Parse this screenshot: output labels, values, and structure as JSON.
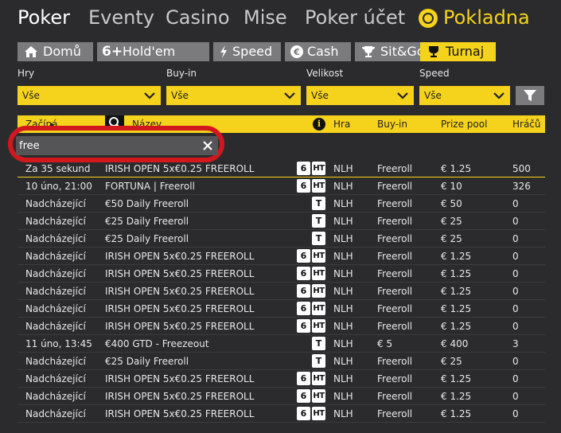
{
  "topnav": {
    "poker": "Poker",
    "eventy": "Eventy",
    "casino": "Casino",
    "mise": "Mise",
    "account": "Poker účet",
    "cashier": "Pokladna"
  },
  "tabs": [
    {
      "label": "Domů",
      "icon": "home-icon"
    },
    {
      "label": "Hold'em",
      "icon": "six-plus-icon",
      "icon_text": "6+"
    },
    {
      "label": "Speed",
      "icon": "lightning-icon"
    },
    {
      "label": "Cash",
      "icon": "euro-icon"
    },
    {
      "label": "Sit&Go",
      "icon": "trophy-icon"
    },
    {
      "label": "Turnaj",
      "icon": "cup-icon",
      "active": true
    }
  ],
  "filters": {
    "games": {
      "label": "Hry",
      "value": "Vše"
    },
    "buyin": {
      "label": "Buy-in",
      "value": "Vše"
    },
    "size": {
      "label": "Velikost",
      "value": "Vše"
    },
    "speed": {
      "label": "Speed",
      "value": "Vše"
    }
  },
  "table": {
    "headers": {
      "starts": "Začíná",
      "name": "Název",
      "info_icon": "i",
      "game": "Hra",
      "buyin": "Buy-in",
      "prize": "Prize pool",
      "players": "Hráčů"
    },
    "search": {
      "value": "free"
    },
    "rows": [
      {
        "starts": "Za 35 sekund",
        "name": "IRISH OPEN 5x€0.25 FREEROLL",
        "b6": "6",
        "ht": "HT",
        "t": "",
        "game": "NLH",
        "buyin": "Freeroll",
        "prize": "€ 1.25",
        "players": "500"
      },
      {
        "starts": "10 úno, 21:00",
        "name": "FORTUNA | Freeroll",
        "b6": "6",
        "ht": "HT",
        "t": "",
        "game": "NLH",
        "buyin": "Freeroll",
        "prize": "€ 10",
        "players": "326"
      },
      {
        "starts": "Nadcházející",
        "name": "€50 Daily Freeroll",
        "b6": "",
        "ht": "",
        "t": "T",
        "game": "NLH",
        "buyin": "Freeroll",
        "prize": "€ 50",
        "players": "0"
      },
      {
        "starts": "Nadcházející",
        "name": "€25 Daily Freeroll",
        "b6": "",
        "ht": "",
        "t": "T",
        "game": "NLH",
        "buyin": "Freeroll",
        "prize": "€ 25",
        "players": "0"
      },
      {
        "starts": "Nadcházející",
        "name": "€25 Daily Freeroll",
        "b6": "",
        "ht": "",
        "t": "T",
        "game": "NLH",
        "buyin": "Freeroll",
        "prize": "€ 25",
        "players": "0"
      },
      {
        "starts": "Nadcházející",
        "name": "IRISH OPEN 5x€0.25 FREEROLL",
        "b6": "6",
        "ht": "HT",
        "t": "",
        "game": "NLH",
        "buyin": "Freeroll",
        "prize": "€ 1.25",
        "players": "0"
      },
      {
        "starts": "Nadcházející",
        "name": "IRISH OPEN 5x€0.25 FREEROLL",
        "b6": "6",
        "ht": "HT",
        "t": "",
        "game": "NLH",
        "buyin": "Freeroll",
        "prize": "€ 1.25",
        "players": "0"
      },
      {
        "starts": "Nadcházející",
        "name": "IRISH OPEN 5x€0.25 FREEROLL",
        "b6": "6",
        "ht": "HT",
        "t": "",
        "game": "NLH",
        "buyin": "Freeroll",
        "prize": "€ 1.25",
        "players": "0"
      },
      {
        "starts": "Nadcházející",
        "name": "IRISH OPEN 5x€0.25 FREEROLL",
        "b6": "6",
        "ht": "HT",
        "t": "",
        "game": "NLH",
        "buyin": "Freeroll",
        "prize": "€ 1.25",
        "players": "0"
      },
      {
        "starts": "Nadcházející",
        "name": "IRISH OPEN 5x€0.25 FREEROLL",
        "b6": "6",
        "ht": "HT",
        "t": "",
        "game": "NLH",
        "buyin": "Freeroll",
        "prize": "€ 1.25",
        "players": "0"
      },
      {
        "starts": "11 úno, 13:45",
        "name": "€400 GTD - Freezeout",
        "b6": "",
        "ht": "",
        "t": "T",
        "game": "NLH",
        "buyin": "€ 5",
        "prize": "€ 400",
        "players": "3"
      },
      {
        "starts": "Nadcházející",
        "name": "€25 Daily Freeroll",
        "b6": "",
        "ht": "",
        "t": "T",
        "game": "NLH",
        "buyin": "Freeroll",
        "prize": "€ 25",
        "players": "0"
      },
      {
        "starts": "Nadcházející",
        "name": "IRISH OPEN 5x€0.25 FREEROLL",
        "b6": "6",
        "ht": "HT",
        "t": "",
        "game": "NLH",
        "buyin": "Freeroll",
        "prize": "€ 1.25",
        "players": "0"
      },
      {
        "starts": "Nadcházející",
        "name": "IRISH OPEN 5x€0.25 FREEROLL",
        "b6": "6",
        "ht": "HT",
        "t": "",
        "game": "NLH",
        "buyin": "Freeroll",
        "prize": "€ 1.25",
        "players": "0"
      },
      {
        "starts": "Nadcházející",
        "name": "IRISH OPEN 5x€0.25 FREEROLL",
        "b6": "6",
        "ht": "HT",
        "t": "",
        "game": "NLH",
        "buyin": "Freeroll",
        "prize": "€ 1.25",
        "players": "0"
      }
    ]
  },
  "colors": {
    "accent": "#f5d31c",
    "background": "#2b2b2d",
    "tab_inactive": "#7b7b7d",
    "highlight_ring": "#d3171e"
  }
}
